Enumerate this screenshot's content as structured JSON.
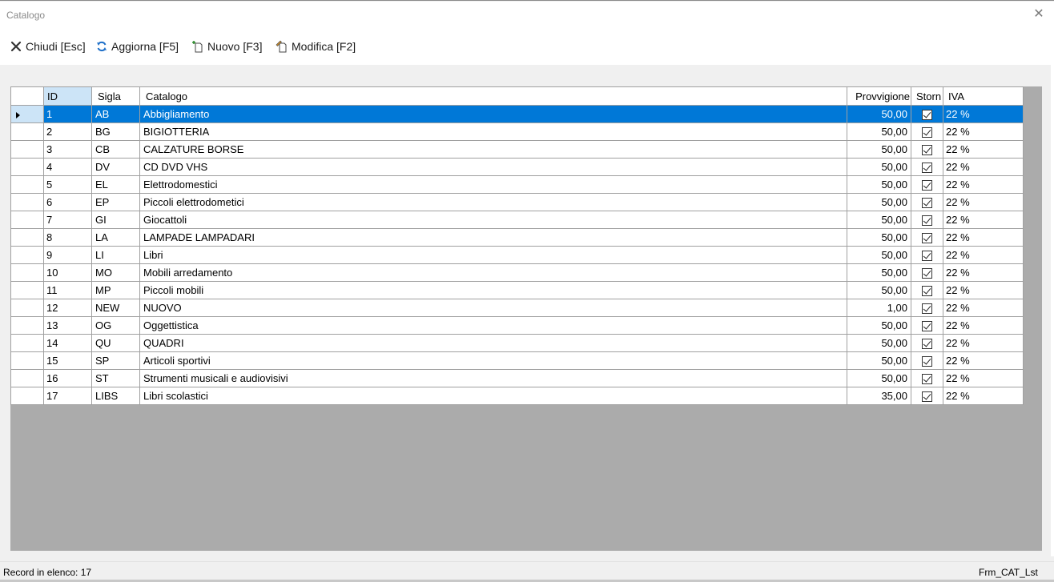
{
  "window": {
    "title": "Catalogo",
    "close_glyph": "✕"
  },
  "toolbar": {
    "buttons": [
      {
        "label": "Chiudi [Esc]",
        "icon": "close-icon"
      },
      {
        "label": "Aggiorna [F5]",
        "icon": "refresh-icon"
      },
      {
        "label": "Nuovo [F3]",
        "icon": "new-document-icon"
      },
      {
        "label": "Modifica [F2]",
        "icon": "edit-document-icon"
      }
    ]
  },
  "grid": {
    "columns": [
      "ID",
      "Sigla",
      "Catalogo",
      "Provvigione",
      "Storn",
      "IVA"
    ],
    "selected_row": 0,
    "rows": [
      {
        "id": "1",
        "sigla": "AB",
        "catalogo": "Abbigliamento",
        "provvigione": "50,00",
        "storn": true,
        "iva": "22 %"
      },
      {
        "id": "2",
        "sigla": "BG",
        "catalogo": "BIGIOTTERIA",
        "provvigione": "50,00",
        "storn": true,
        "iva": "22 %"
      },
      {
        "id": "3",
        "sigla": "CB",
        "catalogo": "CALZATURE BORSE",
        "provvigione": "50,00",
        "storn": true,
        "iva": "22 %"
      },
      {
        "id": "4",
        "sigla": "DV",
        "catalogo": "CD DVD VHS",
        "provvigione": "50,00",
        "storn": true,
        "iva": "22 %"
      },
      {
        "id": "5",
        "sigla": "EL",
        "catalogo": "Elettrodomestici",
        "provvigione": "50,00",
        "storn": true,
        "iva": "22 %"
      },
      {
        "id": "6",
        "sigla": "EP",
        "catalogo": "Piccoli elettrodometici",
        "provvigione": "50,00",
        "storn": true,
        "iva": "22 %"
      },
      {
        "id": "7",
        "sigla": "GI",
        "catalogo": "Giocattoli",
        "provvigione": "50,00",
        "storn": true,
        "iva": "22 %"
      },
      {
        "id": "8",
        "sigla": "LA",
        "catalogo": "LAMPADE LAMPADARI",
        "provvigione": "50,00",
        "storn": true,
        "iva": "22 %"
      },
      {
        "id": "9",
        "sigla": "LI",
        "catalogo": "Libri",
        "provvigione": "50,00",
        "storn": true,
        "iva": "22 %"
      },
      {
        "id": "10",
        "sigla": "MO",
        "catalogo": "Mobili arredamento",
        "provvigione": "50,00",
        "storn": true,
        "iva": "22 %"
      },
      {
        "id": "11",
        "sigla": "MP",
        "catalogo": "Piccoli mobili",
        "provvigione": "50,00",
        "storn": true,
        "iva": "22 %"
      },
      {
        "id": "12",
        "sigla": "NEW",
        "catalogo": "NUOVO",
        "provvigione": "1,00",
        "storn": true,
        "iva": "22 %"
      },
      {
        "id": "13",
        "sigla": "OG",
        "catalogo": "Oggettistica",
        "provvigione": "50,00",
        "storn": true,
        "iva": "22 %"
      },
      {
        "id": "14",
        "sigla": "QU",
        "catalogo": "QUADRI",
        "provvigione": "50,00",
        "storn": true,
        "iva": "22 %"
      },
      {
        "id": "15",
        "sigla": "SP",
        "catalogo": "Articoli sportivi",
        "provvigione": "50,00",
        "storn": true,
        "iva": "22 %"
      },
      {
        "id": "16",
        "sigla": "ST",
        "catalogo": "Strumenti musicali e audiovisivi",
        "provvigione": "50,00",
        "storn": true,
        "iva": "22 %"
      },
      {
        "id": "17",
        "sigla": "LIBS",
        "catalogo": "Libri scolastici",
        "provvigione": "35,00",
        "storn": true,
        "iva": "22 %"
      }
    ]
  },
  "status": {
    "left": "Record in elenco: 17",
    "right": "Frm_CAT_Lst"
  },
  "colors": {
    "selection": "#0078d7",
    "header_selected": "#cce4f7",
    "grid_background": "#ababab"
  }
}
